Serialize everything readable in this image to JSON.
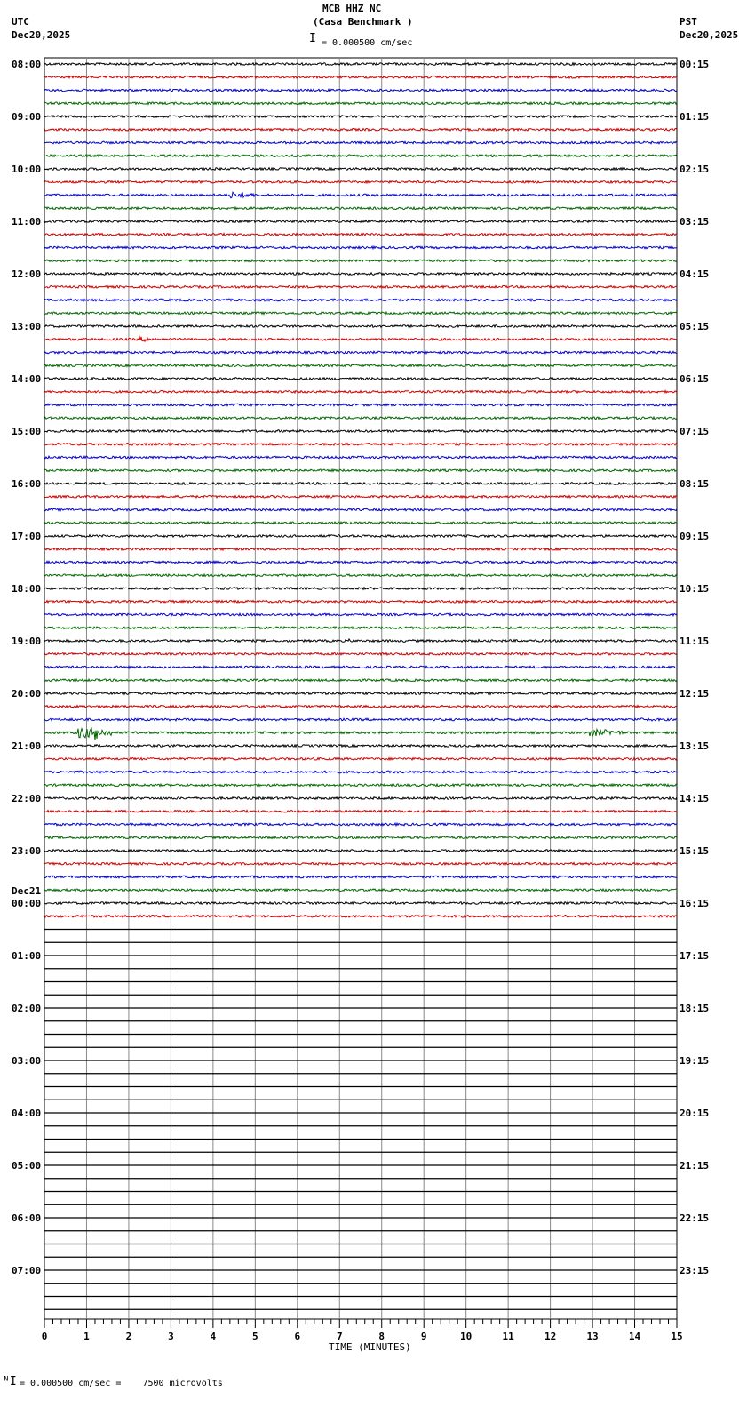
{
  "header": {
    "title": "MCB HHZ NC",
    "subtitle": "(Casa Benchmark )",
    "left_tz": "UTC",
    "left_date": "Dec20,2025",
    "right_tz": "PST",
    "right_date": "Dec20,2025",
    "scale": "= 0.000500 cm/sec"
  },
  "footer": {
    "scale": "= 0.000500 cm/sec =    7500 microvolts"
  },
  "chart_data": {
    "type": "line",
    "kind": "helicorder",
    "xlabel": "TIME (MINUTES)",
    "xlim": [
      0,
      15
    ],
    "x_ticks": [
      "0",
      "1",
      "2",
      "3",
      "4",
      "5",
      "6",
      "7",
      "8",
      "9",
      "10",
      "11",
      "12",
      "13",
      "14",
      "15"
    ],
    "rows_per_hour": 4,
    "total_rows": 96,
    "filled_rows": 66,
    "trace_colors": [
      "#000000",
      "#cc0000",
      "#0000cc",
      "#006600"
    ],
    "left_labels": [
      "08:00",
      "09:00",
      "10:00",
      "11:00",
      "12:00",
      "13:00",
      "14:00",
      "15:00",
      "16:00",
      "17:00",
      "18:00",
      "19:00",
      "20:00",
      "21:00",
      "22:00",
      "23:00",
      "00:00",
      "01:00",
      "02:00",
      "03:00",
      "04:00",
      "05:00",
      "06:00",
      "07:00"
    ],
    "date_change_label": "Dec21",
    "right_labels": [
      "00:15",
      "01:15",
      "02:15",
      "03:15",
      "04:15",
      "05:15",
      "06:15",
      "07:15",
      "08:15",
      "09:15",
      "10:15",
      "11:15",
      "12:15",
      "13:15",
      "14:15",
      "15:15",
      "16:15",
      "17:15",
      "18:15",
      "19:15",
      "20:15",
      "21:15",
      "22:15",
      "23:15"
    ],
    "events": [
      {
        "row": "10:30",
        "start_min": 4.4,
        "end_min": 5.0,
        "amplitude": 3
      },
      {
        "row": "13:15",
        "start_min": 2.2,
        "end_min": 2.7,
        "amplitude": 2.5
      },
      {
        "row": "19:00",
        "start_min": 7.2,
        "end_min": 7.3,
        "amplitude": 2
      },
      {
        "row": "10:00",
        "start_min": 12.6,
        "end_min": 13.0,
        "amplitude": 1.5
      },
      {
        "row": "20:30",
        "start_min": 14.0,
        "end_min": 15.0,
        "amplitude": 1.5
      },
      {
        "row": "20:45",
        "start_min": 0.8,
        "end_min": 1.6,
        "amplitude": 5
      },
      {
        "row": "20:45",
        "start_min": 1.2,
        "end_min": 1.3,
        "amplitude": 12
      },
      {
        "row": "20:45",
        "start_min": 12.9,
        "end_min": 13.7,
        "amplitude": 3.5
      }
    ]
  }
}
